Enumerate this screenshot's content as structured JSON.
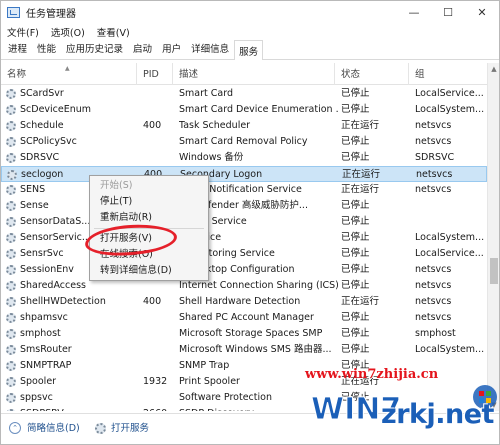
{
  "window": {
    "title": "任务管理器"
  },
  "titlebar_buttons": {
    "minimize": "—",
    "maximize": "☐",
    "close": "✕"
  },
  "menubar": {
    "items": [
      "文件(F)",
      "选项(O)",
      "查看(V)"
    ]
  },
  "tabs": [
    "进程",
    "性能",
    "应用历史记录",
    "启动",
    "用户",
    "详细信息",
    "服务"
  ],
  "active_tab": "服务",
  "columns": {
    "name": "名称",
    "pid": "PID",
    "desc": "描述",
    "status": "状态",
    "group": "组"
  },
  "rows": [
    {
      "name": "SCardSvr",
      "pid": "",
      "desc": "Smart Card",
      "status": "已停止",
      "group": "LocalService..."
    },
    {
      "name": "ScDeviceEnum",
      "pid": "",
      "desc": "Smart Card Device Enumeration ...",
      "status": "已停止",
      "group": "LocalSystem..."
    },
    {
      "name": "Schedule",
      "pid": "400",
      "desc": "Task Scheduler",
      "status": "正在运行",
      "group": "netsvcs"
    },
    {
      "name": "SCPolicySvc",
      "pid": "",
      "desc": "Smart Card Removal Policy",
      "status": "已停止",
      "group": "netsvcs"
    },
    {
      "name": "SDRSVC",
      "pid": "",
      "desc": "Windows 备份",
      "status": "已停止",
      "group": "SDRSVC"
    },
    {
      "name": "seclogon",
      "pid": "400",
      "desc": "Secondary Logon",
      "status": "正在运行",
      "group": "netsvcs"
    },
    {
      "name": "SENS",
      "pid": "",
      "desc": "Event Notification Service",
      "status": "正在运行",
      "group": "netsvcs"
    },
    {
      "name": "Sense",
      "pid": "",
      "desc": "ws Defender 高级威胁防护...",
      "status": "已停止",
      "group": ""
    },
    {
      "name": "SensorDataS...",
      "pid": "",
      "desc": "r Data Service",
      "status": "已停止",
      "group": ""
    },
    {
      "name": "SensorServic...",
      "pid": "",
      "desc": "r Service",
      "status": "已停止",
      "group": "LocalSystem..."
    },
    {
      "name": "SensrSvc",
      "pid": "",
      "desc": "r Monitoring Service",
      "status": "已停止",
      "group": "LocalService..."
    },
    {
      "name": "SessionEnv",
      "pid": "",
      "desc": "e Desktop Configuration",
      "status": "已停止",
      "group": "netsvcs"
    },
    {
      "name": "SharedAccess",
      "pid": "",
      "desc": "Internet Connection Sharing (ICS)",
      "status": "已停止",
      "group": "netsvcs"
    },
    {
      "name": "ShellHWDetection",
      "pid": "400",
      "desc": "Shell Hardware Detection",
      "status": "正在运行",
      "group": "netsvcs"
    },
    {
      "name": "shpamsvc",
      "pid": "",
      "desc": "Shared PC Account Manager",
      "status": "已停止",
      "group": "netsvcs"
    },
    {
      "name": "smphost",
      "pid": "",
      "desc": "Microsoft Storage Spaces SMP",
      "status": "已停止",
      "group": "smphost"
    },
    {
      "name": "SmsRouter",
      "pid": "",
      "desc": "Microsoft Windows SMS 路由器...",
      "status": "已停止",
      "group": "LocalSystem..."
    },
    {
      "name": "SNMPTRAP",
      "pid": "",
      "desc": "SNMP Trap",
      "status": "已停止",
      "group": ""
    },
    {
      "name": "Spooler",
      "pid": "1932",
      "desc": "Print Spooler",
      "status": "正在运行",
      "group": ""
    },
    {
      "name": "sppsvc",
      "pid": "",
      "desc": "Software Protection",
      "status": "已停止",
      "group": ""
    },
    {
      "name": "SSDPSRV",
      "pid": "2660",
      "desc": "SSDP Discovery",
      "status": "",
      "group": ""
    }
  ],
  "selected_row": "seclogon",
  "context_menu": {
    "items": [
      "开始(S)",
      "停止(T)",
      "重新启动(R)",
      "打开服务(V)",
      "在线搜索(O)",
      "转到详细信息(D)"
    ],
    "disabled": [
      "开始(S)"
    ],
    "highlighted": "打开服务(V)"
  },
  "scrollbar": {
    "up": "▲",
    "down": "▼"
  },
  "statusbar": {
    "arrow": "⌃",
    "brief": "简略信息(D)",
    "open_services": "打开服务"
  },
  "watermark": {
    "url": "www.win7zhijia.cn",
    "site": "zrkj.net",
    "logo_text": "WIN7"
  },
  "colors": {
    "highlight_circle": "#e5202a",
    "selection": "#cce4f7",
    "link": "#1e4f8c",
    "watermark_red": "#e4141c",
    "watermark_blue": "#1b5fb8"
  }
}
